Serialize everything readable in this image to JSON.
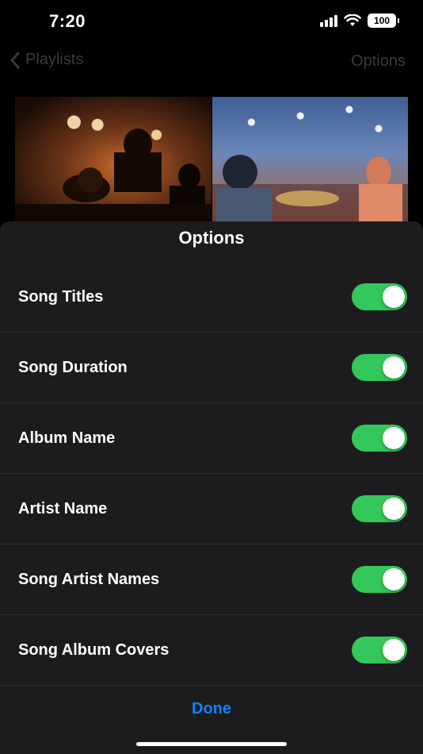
{
  "status_bar": {
    "time": "7:20",
    "battery": "100",
    "icons": [
      "signal-icon",
      "wifi-icon",
      "battery-icon"
    ]
  },
  "nav": {
    "back_label": "Playlists",
    "right_label": "Options",
    "dim_color": "#3a3a3c"
  },
  "sheet": {
    "title": "Options",
    "options": [
      {
        "label": "Song Titles",
        "enabled": true
      },
      {
        "label": "Song Duration",
        "enabled": true
      },
      {
        "label": "Album Name",
        "enabled": true
      },
      {
        "label": "Artist Name",
        "enabled": true
      },
      {
        "label": "Song Artist Names",
        "enabled": true
      },
      {
        "label": "Song Album Covers",
        "enabled": true
      }
    ],
    "done_label": "Done"
  },
  "colors": {
    "toggle_on": "#34c759",
    "accent": "#0a84ff",
    "sheet_bg": "#1c1c1e"
  }
}
